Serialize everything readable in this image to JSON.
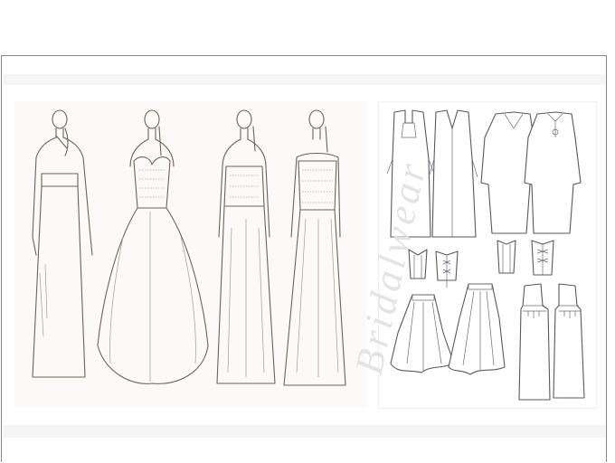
{
  "watermark": {
    "text": "Bridalwear"
  },
  "illustration": {
    "sketches": [
      {
        "name": "long-sleeve-column-gown"
      },
      {
        "name": "sweetheart-ballgown"
      },
      {
        "name": "strapless-column-gown"
      },
      {
        "name": "off-shoulder-lace-gown"
      }
    ],
    "flats": [
      {
        "name": "long-gown-front"
      },
      {
        "name": "long-gown-back"
      },
      {
        "name": "caftan-front"
      },
      {
        "name": "caftan-back"
      },
      {
        "name": "corset-a-front"
      },
      {
        "name": "corset-a-back"
      },
      {
        "name": "corset-b-front"
      },
      {
        "name": "corset-b-back"
      },
      {
        "name": "hi-lo-skirt-front"
      },
      {
        "name": "hi-lo-skirt-back"
      },
      {
        "name": "strapless-column-front"
      },
      {
        "name": "strapless-column-back"
      }
    ]
  },
  "colors": {
    "sketch_line": "#6f6258",
    "flat_line": "#5b5568",
    "band": "#f5f5f5",
    "frame": "#8a8a8a"
  }
}
